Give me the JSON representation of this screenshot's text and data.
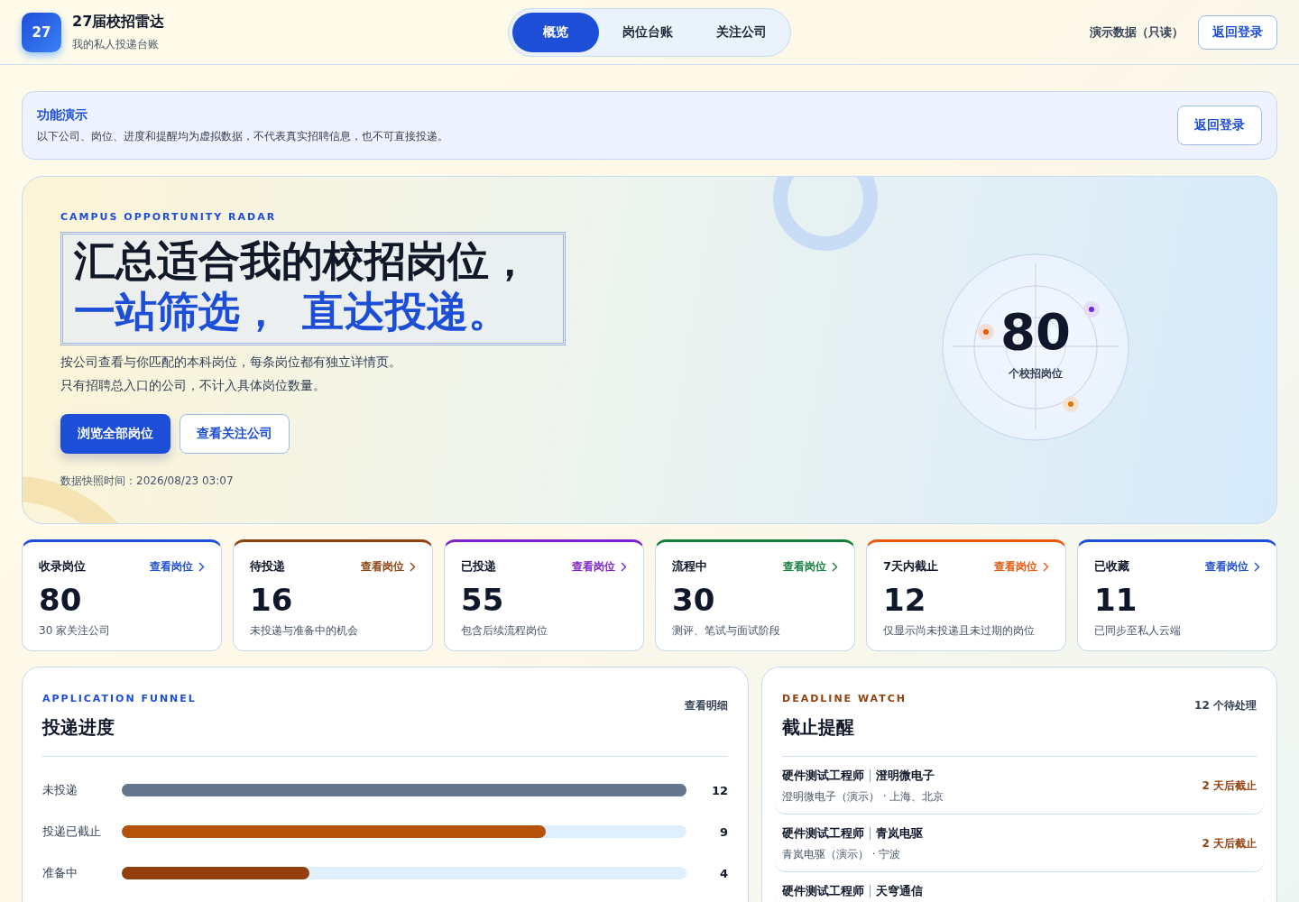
{
  "header": {
    "logo": "27",
    "title": "27届校招雷达",
    "subtitle": "我的私人投递台账",
    "tabs": [
      {
        "label": "概览",
        "selected": true
      },
      {
        "label": "岗位台账",
        "selected": false
      },
      {
        "label": "关注公司",
        "selected": false
      }
    ],
    "mode": "演示数据（只读）",
    "login": "返回登录"
  },
  "notice": {
    "title": "功能演示",
    "text": "以下公司、岗位、进度和提醒均为虚拟数据，不代表真实招聘信息，也不可直接投递。",
    "button": "返回登录"
  },
  "hero": {
    "eyebrow": "CAMPUS OPPORTUNITY RADAR",
    "headline_1": "汇总适合我的校招岗位，",
    "headline_2": "一站筛选，  直达投递。",
    "lines": [
      "按公司查看与你匹配的本科岗位，每条岗位都有独立详情页。",
      "只有招聘总入口的公司，不计入具体岗位数量。"
    ],
    "primary": "浏览全部岗位",
    "secondary": "查看关注公司",
    "snapshot": "数据快照时间：2026/08/23 03:07",
    "radar": {
      "value": "80",
      "label": "个校招岗位"
    }
  },
  "stats": [
    {
      "title": "收录岗位",
      "link": "查看岗位",
      "value": "80",
      "note": "30 家关注公司",
      "color": "#1d4ed8"
    },
    {
      "title": "待投递",
      "link": "查看岗位",
      "value": "16",
      "note": "未投递与准备中的机会",
      "color": "#92400e"
    },
    {
      "title": "已投递",
      "link": "查看岗位",
      "value": "55",
      "note": "包含后续流程岗位",
      "color": "#7e22ce"
    },
    {
      "title": "流程中",
      "link": "查看岗位",
      "value": "30",
      "note": "测评、笔试与面试阶段",
      "color": "#15803d"
    },
    {
      "title": "7天内截止",
      "link": "查看岗位",
      "value": "12",
      "note": "仅显示尚未投递且未过期的岗位",
      "color": "#ea580c"
    },
    {
      "title": "已收藏",
      "link": "查看岗位",
      "value": "11",
      "note": "已同步至私人云端",
      "color": "#1d4ed8"
    }
  ],
  "funnel": {
    "eyebrow": "APPLICATION FUNNEL",
    "title": "投递进度",
    "action": "查看明细",
    "rows": [
      {
        "label": "未投递",
        "level": 1,
        "count": "12",
        "color": "#64748b"
      },
      {
        "label": "投递已截止",
        "level": 0.75,
        "count": "9",
        "color": "#b45309"
      },
      {
        "label": "准备中",
        "level": 0.333,
        "count": "4",
        "color": "#92400e"
      }
    ]
  },
  "deadlines": {
    "eyebrow": "DEADLINE WATCH",
    "title": "截止提醒",
    "count": "12 个待处理",
    "items": [
      {
        "role": "硬件测试工程师",
        "company": "澄明微电子",
        "meta": "澄明微电子（演示） · 上海、北京",
        "due": "2 天后截止"
      },
      {
        "role": "硬件测试工程师",
        "company": "青岚电驱",
        "meta": "青岚电驱（演示） · 宁波",
        "due": "2 天后截止"
      },
      {
        "role": "硬件测试工程师",
        "company": "天穹通信"
      }
    ]
  }
}
